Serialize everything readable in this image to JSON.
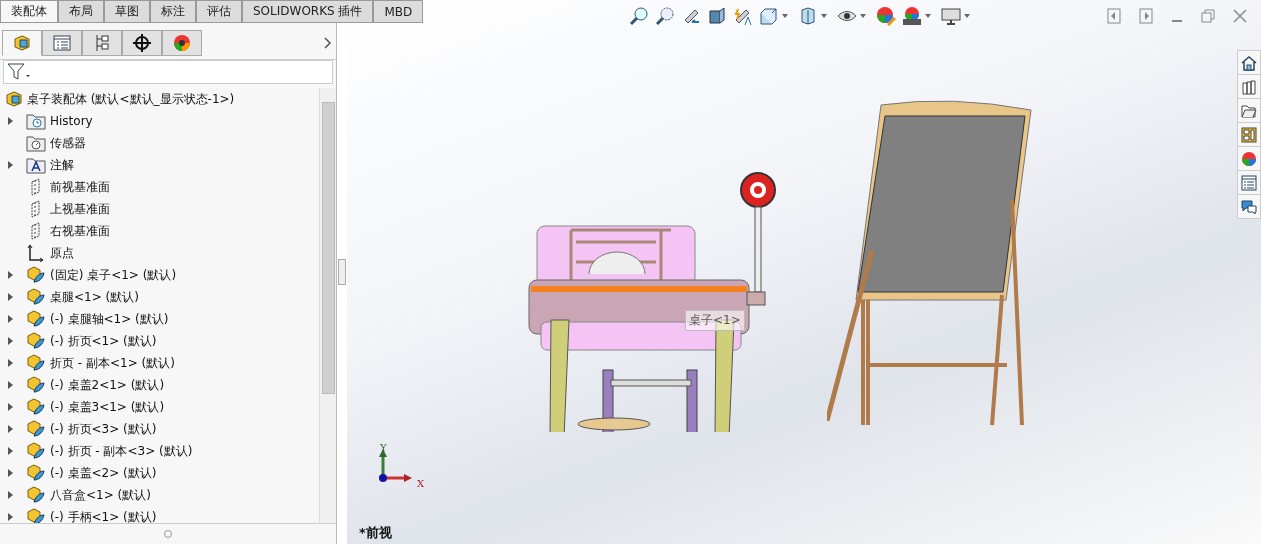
{
  "command_tabs": [
    {
      "label": "装配体",
      "selected": true
    },
    {
      "label": "布局",
      "selected": false
    },
    {
      "label": "草图",
      "selected": false
    },
    {
      "label": "标注",
      "selected": false
    },
    {
      "label": "评估",
      "selected": false
    },
    {
      "label": "SOLIDWORKS 插件",
      "selected": false
    },
    {
      "label": "MBD",
      "selected": false
    }
  ],
  "manager_tabs": [
    {
      "kind": "feature",
      "selected": true
    },
    {
      "kind": "property",
      "selected": false
    },
    {
      "kind": "config",
      "selected": false
    },
    {
      "kind": "dim",
      "selected": false
    },
    {
      "kind": "display",
      "selected": false
    }
  ],
  "tree": {
    "root": "桌子装配体  (默认<默认_显示状态-1>)",
    "items": [
      {
        "kind": "history",
        "label": "History",
        "collapsible": true
      },
      {
        "kind": "sensor",
        "label": "传感器",
        "collapsible": false
      },
      {
        "kind": "annotation",
        "label": "注解",
        "collapsible": true
      },
      {
        "kind": "plane",
        "label": "前视基准面",
        "collapsible": false
      },
      {
        "kind": "plane",
        "label": "上视基准面",
        "collapsible": false
      },
      {
        "kind": "plane",
        "label": "右视基准面",
        "collapsible": false
      },
      {
        "kind": "origin",
        "label": "原点",
        "collapsible": false
      },
      {
        "kind": "component",
        "label": "(固定) 桌子<1> (默认)",
        "collapsible": true
      },
      {
        "kind": "component",
        "label": "桌腿<1> (默认)",
        "collapsible": true
      },
      {
        "kind": "component",
        "label": "(-) 桌腿轴<1> (默认)",
        "collapsible": true
      },
      {
        "kind": "component",
        "label": "(-) 折页<1> (默认)",
        "collapsible": true
      },
      {
        "kind": "component",
        "label": "折页 - 副本<1> (默认)",
        "collapsible": true
      },
      {
        "kind": "component",
        "label": "(-) 桌盖2<1> (默认)",
        "collapsible": true
      },
      {
        "kind": "component",
        "label": "(-) 桌盖3<1> (默认)",
        "collapsible": true
      },
      {
        "kind": "component",
        "label": "(-) 折页<3> (默认)",
        "collapsible": true
      },
      {
        "kind": "component",
        "label": "(-) 折页 - 副本<3> (默认)",
        "collapsible": true
      },
      {
        "kind": "component",
        "label": "(-) 桌盖<2> (默认)",
        "collapsible": true
      },
      {
        "kind": "component",
        "label": "八音盒<1> (默认)",
        "collapsible": true
      },
      {
        "kind": "component",
        "label": "(-) 手柄<1> (默认)",
        "collapsible": true
      }
    ]
  },
  "viewport": {
    "tooltip": "桌子<1>",
    "axis_y": "Y",
    "axis_x": "X",
    "view_name": "*前视"
  },
  "task_pane": [
    {
      "kind": "home"
    },
    {
      "kind": "library"
    },
    {
      "kind": "folder"
    },
    {
      "kind": "palette"
    },
    {
      "kind": "appearance"
    },
    {
      "kind": "properties"
    },
    {
      "kind": "forum"
    }
  ]
}
